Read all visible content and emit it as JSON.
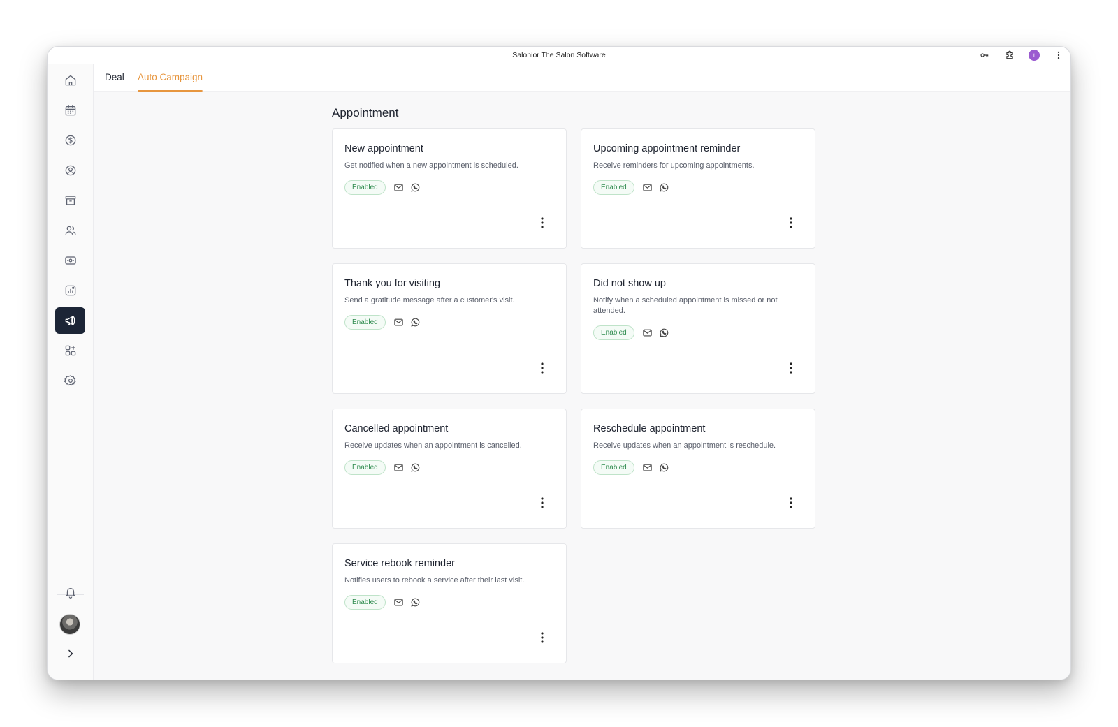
{
  "window": {
    "title": "Salonior The Salon Software",
    "profile_initial": "t"
  },
  "titlebar_icons": [
    "key-icon",
    "extension-icon",
    "profile-avatar",
    "more-vertical-icon"
  ],
  "sidebar": {
    "items": [
      {
        "icon": "home-icon"
      },
      {
        "icon": "calendar-icon"
      },
      {
        "icon": "dollar-icon"
      },
      {
        "icon": "user-circle-icon"
      },
      {
        "icon": "archive-icon"
      },
      {
        "icon": "users-icon"
      },
      {
        "icon": "cash-icon"
      },
      {
        "icon": "reports-icon"
      },
      {
        "icon": "megaphone-icon",
        "active": true
      },
      {
        "icon": "apps-add-icon"
      },
      {
        "icon": "settings-icon"
      }
    ],
    "bottom": [
      "bell-icon",
      "user-avatar",
      "chevron-right-icon"
    ]
  },
  "tabs": [
    {
      "label": "Deal",
      "active": false
    },
    {
      "label": "Auto Campaign",
      "active": true
    }
  ],
  "section": {
    "title": "Appointment"
  },
  "cards": [
    {
      "title": "New appointment",
      "description": "Get notified when a new appointment is scheduled.",
      "status": "Enabled"
    },
    {
      "title": "Upcoming appointment reminder",
      "description": "Receive reminders for upcoming appointments.",
      "status": "Enabled"
    },
    {
      "title": "Thank you for visiting",
      "description": "Send a gratitude message after a customer's visit.",
      "status": "Enabled"
    },
    {
      "title": "Did not show up",
      "description": "Notify when a scheduled appointment is missed or not attended.",
      "status": "Enabled"
    },
    {
      "title": "Cancelled appointment",
      "description": "Receive updates when an appointment is cancelled.",
      "status": "Enabled"
    },
    {
      "title": "Reschedule appointment",
      "description": "Receive updates when an appointment is reschedule.",
      "status": "Enabled"
    },
    {
      "title": "Service rebook reminder",
      "description": "Notifies users to rebook a service after their last visit.",
      "status": "Enabled"
    }
  ],
  "colors": {
    "accent": "#e7963f",
    "nav_active": "#1c2536",
    "badge_text": "#2e8b4e",
    "badge_border": "#bfe3c9",
    "avatar": "#9b5bd0"
  }
}
